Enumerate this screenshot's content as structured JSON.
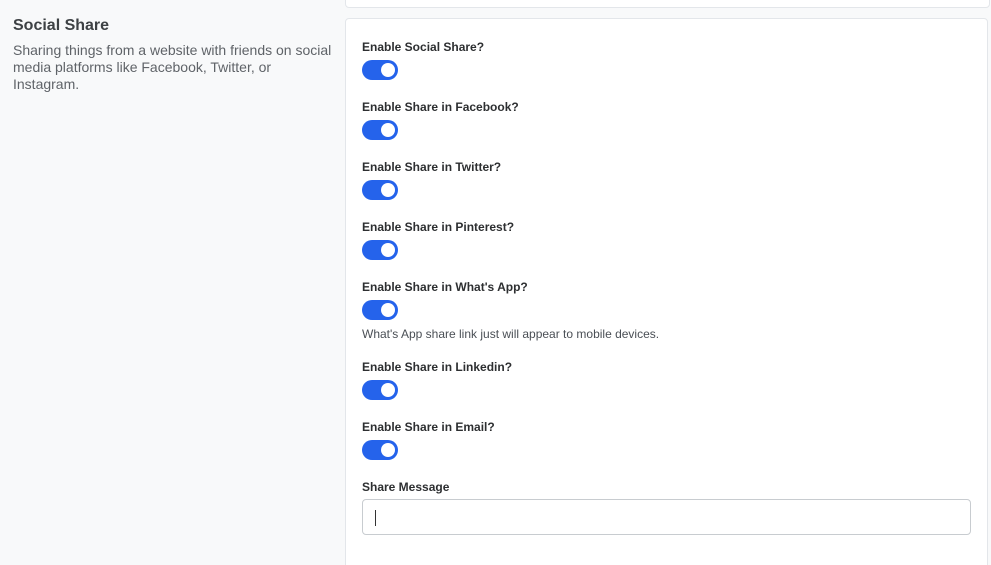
{
  "section": {
    "title": "Social Share",
    "description": "Sharing things from a website with friends on social media platforms like Facebook, Twitter, or Instagram."
  },
  "settings": [
    {
      "key": "enable_social_share",
      "label": "Enable Social Share?",
      "enabled": true
    },
    {
      "key": "enable_facebook",
      "label": "Enable Share in Facebook?",
      "enabled": true
    },
    {
      "key": "enable_twitter",
      "label": "Enable Share in Twitter?",
      "enabled": true
    },
    {
      "key": "enable_pinterest",
      "label": "Enable Share in Pinterest?",
      "enabled": true
    },
    {
      "key": "enable_whatsapp",
      "label": "Enable Share in What's App?",
      "enabled": true,
      "help": "What's App share link just will appear to mobile devices."
    },
    {
      "key": "enable_linkedin",
      "label": "Enable Share in Linkedin?",
      "enabled": true
    },
    {
      "key": "enable_email",
      "label": "Enable Share in Email?",
      "enabled": true
    }
  ],
  "share_message": {
    "label": "Share Message",
    "value": "",
    "placeholder": ""
  },
  "colors": {
    "toggle_on": "#2563eb",
    "card_border": "#e3e6ea",
    "page_background": "#f8f9fa"
  }
}
